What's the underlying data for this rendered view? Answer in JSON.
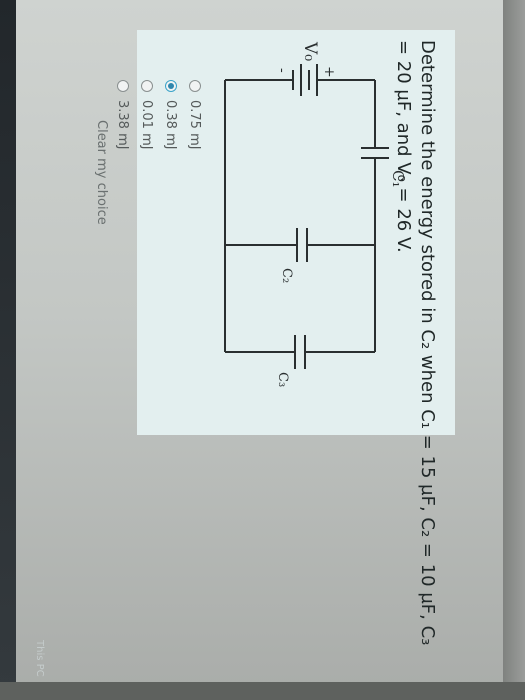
{
  "question": {
    "text": "Determine the energy stored in C₂ when C₁ = 15 µF, C₂ = 10 µF, C₃ = 20 µF, and V₀ = 26 V."
  },
  "circuit": {
    "labels": {
      "source": "V₀",
      "plus": "+",
      "minus": "-",
      "c1": "C₁",
      "c2": "C₂",
      "c3": "C₃"
    }
  },
  "options": [
    {
      "label": "0.75 mJ",
      "selected": false
    },
    {
      "label": "0.38 mJ",
      "selected": true
    },
    {
      "label": "0.01 mJ",
      "selected": false
    },
    {
      "label": "3.38 mJ",
      "selected": false
    }
  ],
  "clear_choice": "Clear my choice",
  "taskbar": {
    "this_pc": "This PC"
  },
  "colors": {
    "panel": "#e3efef",
    "selected_radio": "#2f86ad",
    "circuit_line": "#2a2f30"
  }
}
